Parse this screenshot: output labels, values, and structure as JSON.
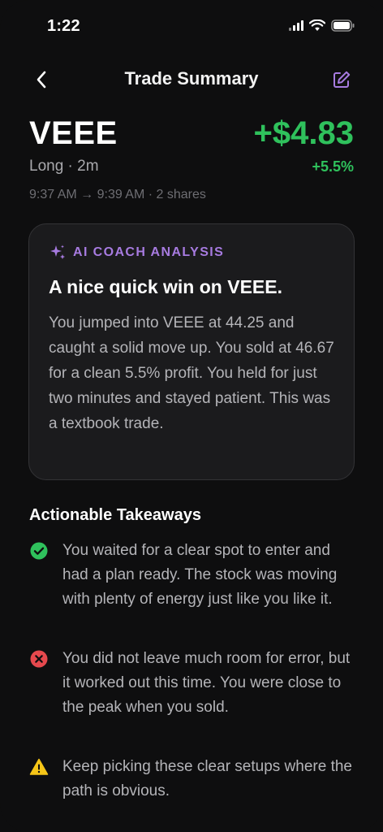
{
  "status_bar": {
    "time": "1:22"
  },
  "nav": {
    "title": "Trade Summary"
  },
  "trade": {
    "ticker": "VEEE",
    "meta": "Long · 2m",
    "pnl": "+$4.83",
    "pnl_pct": "+5.5%",
    "time_range": "9:37 AM → 9:39 AM · 2 shares"
  },
  "coach": {
    "label": "AI COACH ANALYSIS",
    "title": "A nice quick win on VEEE.",
    "body": "You jumped into VEEE at 44.25 and caught a solid move up. You sold at 46.67 for a clean 5.5% profit. You held for just two minutes and stayed patient. This was a textbook trade."
  },
  "takeaways": {
    "title": "Actionable Takeaways",
    "items": [
      {
        "type": "success",
        "icon": "check-circle-icon",
        "text": "You waited for a clear spot to enter and had a plan ready. The stock was moving with plenty of energy just like you like it."
      },
      {
        "type": "error",
        "icon": "x-circle-icon",
        "text": "You did not leave much room for error, but it worked out this time. You were close to the peak when you sold."
      },
      {
        "type": "warning",
        "icon": "warning-triangle-icon",
        "text": "Keep picking these clear setups where the path is obvious."
      }
    ]
  },
  "colors": {
    "accent": "#a77be0",
    "profit": "#2fc15c",
    "error": "#e5484d",
    "warning": "#f5c518",
    "background": "#0e0e0f",
    "card": "#1b1b1d"
  }
}
